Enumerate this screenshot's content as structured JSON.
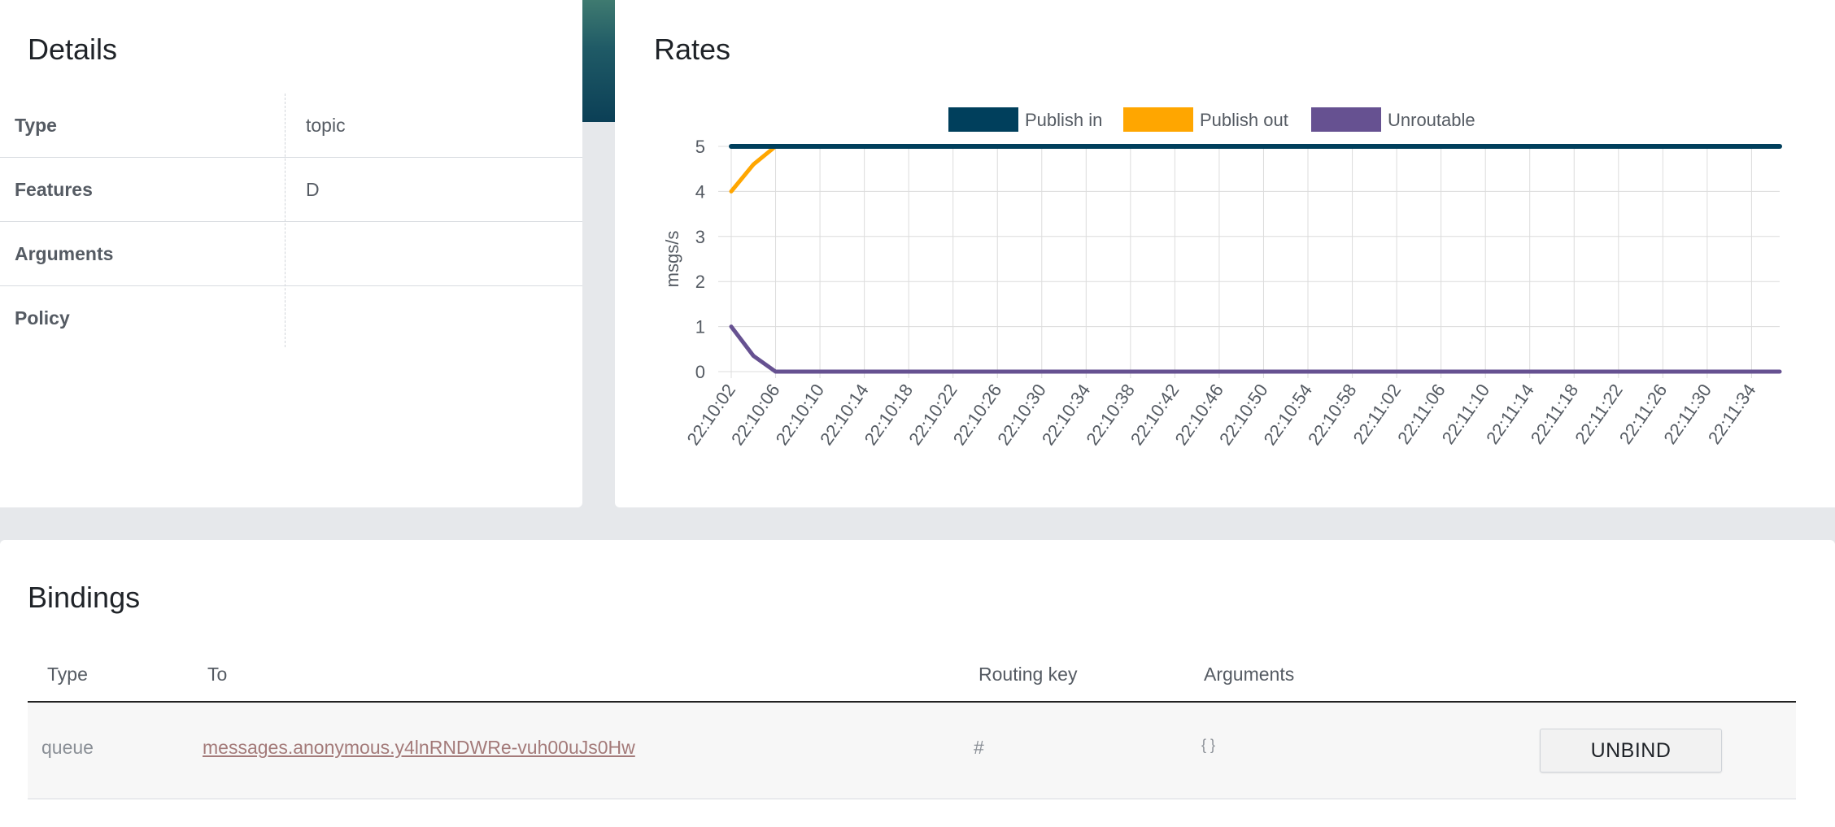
{
  "details": {
    "title": "Details",
    "rows": [
      {
        "key": "Type",
        "value": "topic"
      },
      {
        "key": "Features",
        "value": "D"
      },
      {
        "key": "Arguments",
        "value": ""
      },
      {
        "key": "Policy",
        "value": ""
      }
    ]
  },
  "rates": {
    "title": "Rates"
  },
  "chart_data": {
    "type": "line",
    "title": "",
    "xlabel": "",
    "ylabel": "msgs/s",
    "ylim": [
      0,
      5
    ],
    "yticks": [
      "0",
      "1",
      "2",
      "3",
      "4",
      "5"
    ],
    "grid": true,
    "legend_position": "top-center",
    "x": [
      "22:10:02",
      "22:10:04",
      "22:10:06",
      "22:10:08",
      "22:10:10",
      "22:10:12",
      "22:10:14",
      "22:10:16",
      "22:10:18",
      "22:10:20",
      "22:10:22",
      "22:10:24",
      "22:10:26",
      "22:10:28",
      "22:10:30",
      "22:10:32",
      "22:10:34",
      "22:10:36",
      "22:10:38",
      "22:10:40",
      "22:10:42",
      "22:10:44",
      "22:10:46",
      "22:10:48",
      "22:10:50",
      "22:10:52",
      "22:10:54",
      "22:10:56",
      "22:10:58",
      "22:11:00",
      "22:11:02",
      "22:11:04",
      "22:11:06",
      "22:11:08",
      "22:11:10",
      "22:11:12",
      "22:11:14",
      "22:11:16",
      "22:11:18",
      "22:11:20",
      "22:11:22",
      "22:11:24",
      "22:11:26",
      "22:11:28",
      "22:11:30",
      "22:11:32",
      "22:11:34",
      "22:11:36"
    ],
    "xticks": [
      "22:10:02",
      "22:10:06",
      "22:10:10",
      "22:10:14",
      "22:10:18",
      "22:10:22",
      "22:10:26",
      "22:10:30",
      "22:10:34",
      "22:10:38",
      "22:10:42",
      "22:10:46",
      "22:10:50",
      "22:10:54",
      "22:10:58",
      "22:11:02",
      "22:11:06",
      "22:11:10",
      "22:11:14",
      "22:11:18",
      "22:11:22",
      "22:11:26",
      "22:11:30",
      "22:11:34"
    ],
    "series": [
      {
        "name": "Publish in",
        "color": "#003f5c",
        "values": [
          5,
          5,
          5,
          5,
          5,
          5,
          5,
          5,
          5,
          5,
          5,
          5,
          5,
          5,
          5,
          5,
          5,
          5,
          5,
          5,
          5,
          5,
          5,
          5,
          5,
          5,
          5,
          5,
          5,
          5,
          5,
          5,
          5,
          5,
          5,
          5,
          5,
          5,
          5,
          5,
          5,
          5,
          5,
          5,
          5,
          5,
          5,
          5
        ]
      },
      {
        "name": "Publish out",
        "color": "#ffa600",
        "values": [
          4,
          4.6,
          5,
          5,
          5,
          5,
          5,
          5,
          5,
          5,
          5,
          5,
          5,
          5,
          5,
          5,
          5,
          5,
          5,
          5,
          5,
          5,
          5,
          5,
          5,
          5,
          5,
          5,
          5,
          5,
          5,
          5,
          5,
          5,
          5,
          5,
          5,
          5,
          5,
          5,
          5,
          5,
          5,
          5,
          5,
          5,
          5,
          5
        ]
      },
      {
        "name": "Unroutable",
        "color": "#665191",
        "values": [
          1,
          0.35,
          0,
          0,
          0,
          0,
          0,
          0,
          0,
          0,
          0,
          0,
          0,
          0,
          0,
          0,
          0,
          0,
          0,
          0,
          0,
          0,
          0,
          0,
          0,
          0,
          0,
          0,
          0,
          0,
          0,
          0,
          0,
          0,
          0,
          0,
          0,
          0,
          0,
          0,
          0,
          0,
          0,
          0,
          0,
          0,
          0,
          0
        ]
      }
    ]
  },
  "bindings": {
    "title": "Bindings",
    "headers": {
      "type": "Type",
      "to": "To",
      "routing_key": "Routing key",
      "arguments": "Arguments"
    },
    "rows": [
      {
        "type": "queue",
        "to": "messages.anonymous.y4lnRNDWRe-vuh00uJs0Hw",
        "routing_key": "#",
        "arguments": "{ }",
        "action": "UNBIND"
      }
    ]
  }
}
